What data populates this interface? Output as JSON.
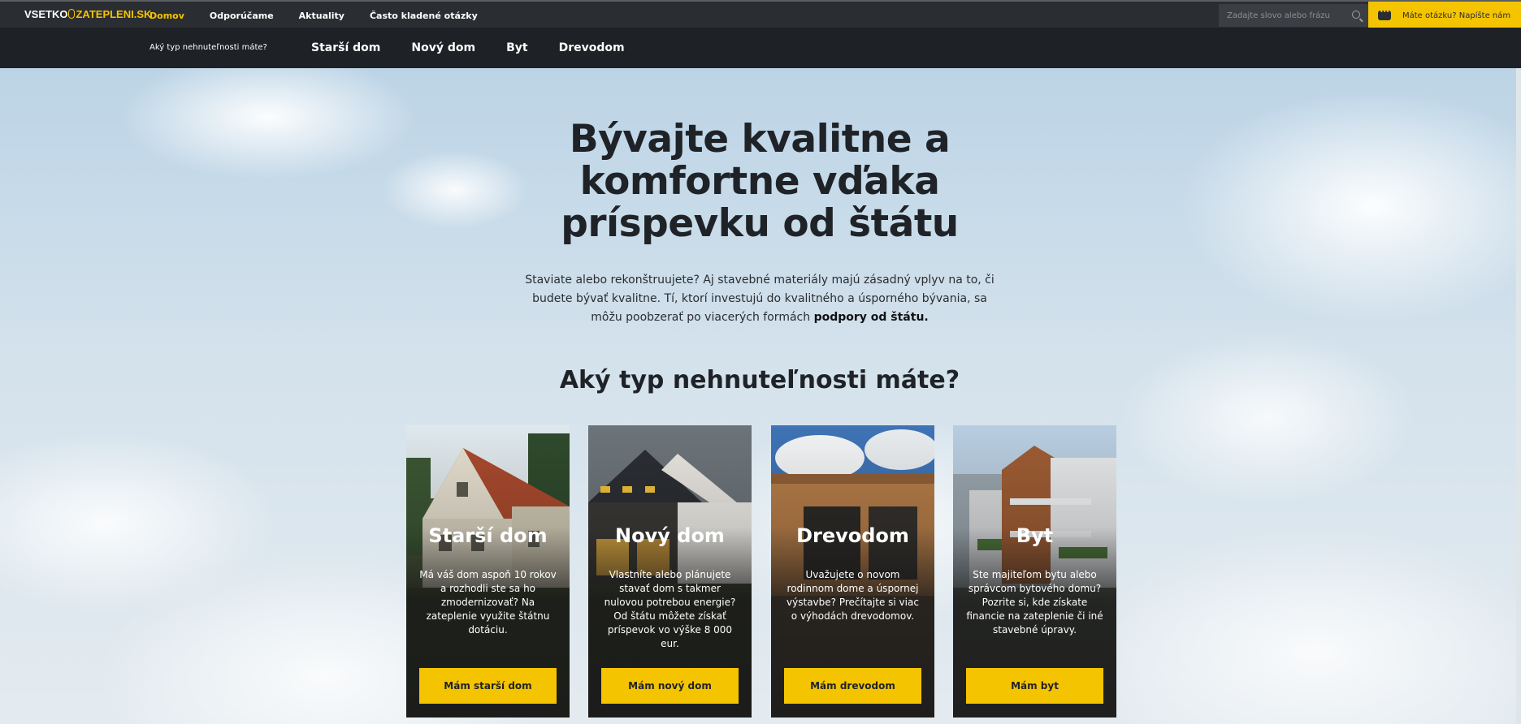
{
  "brand": {
    "part1": "VSETKO",
    "part2": "ZATEPLENI.SK"
  },
  "topnav": {
    "items": [
      "Domov",
      "Odporúčame",
      "Aktuality",
      "Často kladené otázky"
    ]
  },
  "search": {
    "placeholder": "Zadajte slovo alebo frázu"
  },
  "contact": {
    "label": "Máte otázku? Napíšte nám"
  },
  "subnav": {
    "question": "Aký typ nehnuteľnosti máte?",
    "items": [
      "Starší dom",
      "Nový dom",
      "Byt",
      "Drevodom"
    ]
  },
  "hero": {
    "title_line1": "Bývajte kvalitne a",
    "title_line2": "komfortne vďaka",
    "title_line3": "príspevku od štátu",
    "lead_text": "Staviate alebo rekonštruujete? Aj stavebné materiály majú zásadný vplyv na to, či budete bývať kvalitne. Tí, ktorí investujú do kvalitného a úsporného bývania, sa môžu poobzerať po viacerých formách ",
    "lead_bold": "podpory od štátu.",
    "section_title": "Aký typ nehnuteľnosti máte?"
  },
  "cards": [
    {
      "title": "Starší dom",
      "desc": "Má váš dom aspoň 10 rokov a rozhodli ste sa ho zmodernizovať? Na zateplenie využite štátnu dotáciu.",
      "button": "Mám starší dom"
    },
    {
      "title": "Nový dom",
      "desc": "Vlastníte alebo plánujete stavať dom s takmer nulovou potrebou energie? Od štátu môžete získať príspevok vo výške 8 000 eur.",
      "button": "Mám nový dom"
    },
    {
      "title": "Drevodom",
      "desc": "Uvažujete o novom rodinnom dome a úspornej výstavbe? Prečítajte si viac o výhodách drevodomov.",
      "button": "Mám drevodom"
    },
    {
      "title": "Byt",
      "desc": "Ste majiteľom bytu alebo správcom bytového domu? Pozrite si, kde získate financie na zateplenie či iné stavebné úpravy.",
      "button": "Mám byt"
    }
  ],
  "colors": {
    "accent": "#f5c400",
    "topbar": "#2a2d31",
    "subbar": "#1e2125"
  }
}
